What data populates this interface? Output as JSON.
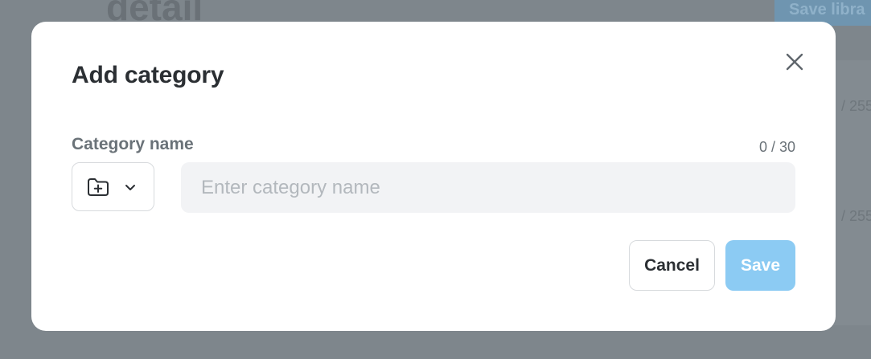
{
  "background": {
    "title": "detail",
    "save_button": "Save libra",
    "counter_1": "/ 255",
    "counter_2": "/ 255"
  },
  "modal": {
    "title": "Add category",
    "close_icon": "close-icon",
    "field": {
      "label": "Category name",
      "counter": "0 / 30",
      "placeholder": "Enter category name",
      "value": ""
    },
    "icon_picker": {
      "icon": "folder-plus-icon",
      "caret": "chevron-down-icon"
    },
    "buttons": {
      "cancel": "Cancel",
      "save": "Save"
    },
    "colors": {
      "save_button": "#8ccbf3",
      "overlay": "#7e868c"
    }
  }
}
